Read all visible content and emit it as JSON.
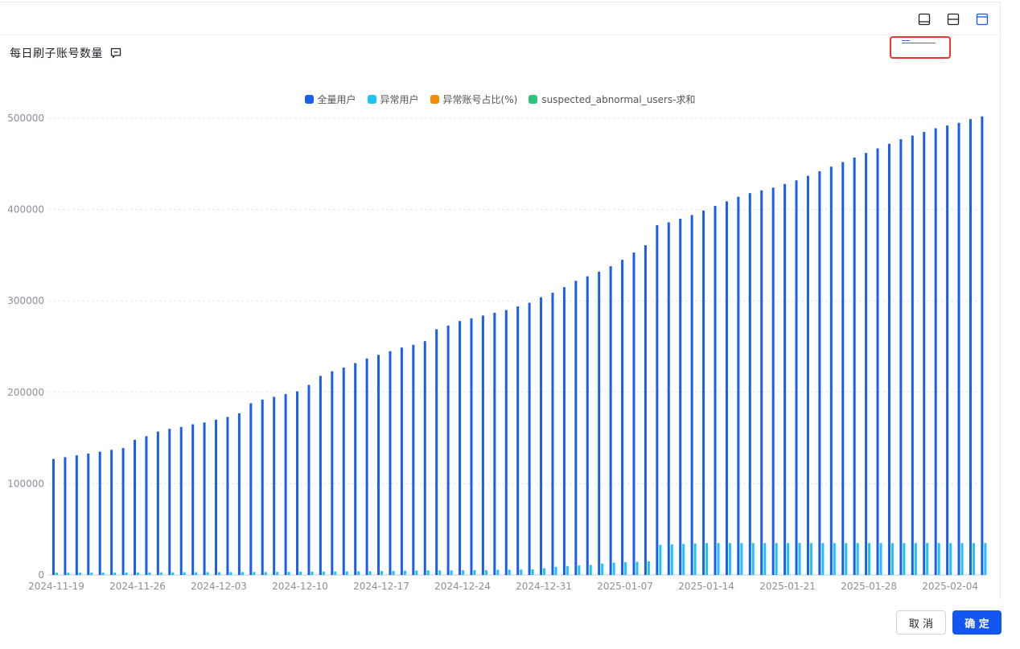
{
  "title": "每日刷子账号数量",
  "toolbar": {
    "icons": [
      "layout-bottom-panel-icon",
      "layout-split-horizontal-icon",
      "layout-top-panel-icon"
    ]
  },
  "footer": {
    "cancel_label": "取 消",
    "ok_label": "确 定"
  },
  "colors": {
    "all_users": "#1a5ef0",
    "abnormal_users": "#1ec3f5",
    "ratio": "#f58a07",
    "suspected_sum": "#2ec47a",
    "highlight": "#e53935",
    "primary_button": "#1456f0"
  },
  "chart_data": {
    "type": "bar",
    "title": "",
    "xlabel": "",
    "ylabel": "",
    "ylim": [
      0,
      500000
    ],
    "yticks": [
      "0",
      "100000",
      "200000",
      "300000",
      "400000",
      "500000"
    ],
    "xtick_labels": [
      "2024-11-19",
      "2024-11-26",
      "2024-12-03",
      "2024-12-10",
      "2024-12-17",
      "2024-12-24",
      "2024-12-31",
      "2025-01-07",
      "2025-01-14",
      "2025-01-21",
      "2025-01-28",
      "2025-02-04"
    ],
    "legend": {
      "position": "top-center",
      "items": [
        "全量用户",
        "异常用户",
        "异常账号占比(%)",
        "suspected_abnormal_users-求和"
      ]
    },
    "grid": true,
    "categories": [
      "2024-11-19",
      "2024-11-20",
      "2024-11-21",
      "2024-11-22",
      "2024-11-23",
      "2024-11-24",
      "2024-11-25",
      "2024-11-26",
      "2024-11-27",
      "2024-11-28",
      "2024-11-29",
      "2024-11-30",
      "2024-12-01",
      "2024-12-02",
      "2024-12-03",
      "2024-12-04",
      "2024-12-05",
      "2024-12-06",
      "2024-12-07",
      "2024-12-08",
      "2024-12-09",
      "2024-12-10",
      "2024-12-11",
      "2024-12-12",
      "2024-12-13",
      "2024-12-14",
      "2024-12-15",
      "2024-12-16",
      "2024-12-17",
      "2024-12-18",
      "2024-12-19",
      "2024-12-20",
      "2024-12-21",
      "2024-12-22",
      "2024-12-23",
      "2024-12-24",
      "2024-12-25",
      "2024-12-26",
      "2024-12-27",
      "2024-12-28",
      "2024-12-29",
      "2024-12-30",
      "2024-12-31",
      "2025-01-01",
      "2025-01-02",
      "2025-01-03",
      "2025-01-04",
      "2025-01-05",
      "2025-01-06",
      "2025-01-07",
      "2025-01-08",
      "2025-01-09",
      "2025-01-10",
      "2025-01-11",
      "2025-01-12",
      "2025-01-13",
      "2025-01-14",
      "2025-01-15",
      "2025-01-16",
      "2025-01-17",
      "2025-01-18",
      "2025-01-19",
      "2025-01-20",
      "2025-01-21",
      "2025-01-22",
      "2025-01-23",
      "2025-01-24",
      "2025-01-25",
      "2025-01-26",
      "2025-01-27",
      "2025-01-28",
      "2025-01-29",
      "2025-01-30",
      "2025-01-31",
      "2025-02-01",
      "2025-02-02",
      "2025-02-03",
      "2025-02-04",
      "2025-02-05",
      "2025-02-06",
      "2025-02-07"
    ],
    "series": [
      {
        "name": "全量用户",
        "values": [
          127000,
          129000,
          131000,
          133000,
          135000,
          137000,
          139000,
          148000,
          152000,
          157000,
          160000,
          162000,
          165000,
          167000,
          170000,
          173000,
          177000,
          188000,
          192000,
          195000,
          198000,
          201000,
          208000,
          218000,
          223000,
          227000,
          232000,
          237000,
          241000,
          245000,
          249000,
          252000,
          256000,
          269000,
          273000,
          278000,
          281000,
          284000,
          287000,
          290000,
          294000,
          298000,
          304000,
          309000,
          315000,
          322000,
          327000,
          332000,
          338000,
          345000,
          353000,
          361000,
          383000,
          386000,
          390000,
          394000,
          399000,
          404000,
          409000,
          414000,
          418000,
          421000,
          424000,
          428000,
          432000,
          437000,
          442000,
          447000,
          452000,
          457000,
          462000,
          467000,
          472000,
          477000,
          481000,
          485000,
          489000,
          492000,
          495000,
          499000,
          502000
        ]
      },
      {
        "name": "异常用户",
        "values": [
          2500,
          2500,
          2500,
          2600,
          2600,
          2700,
          2700,
          2800,
          2800,
          2900,
          2900,
          3000,
          3000,
          3100,
          3100,
          3200,
          3200,
          3300,
          3300,
          3400,
          3400,
          3500,
          3600,
          3700,
          3800,
          3900,
          4000,
          4100,
          4300,
          4500,
          4700,
          4800,
          5000,
          5000,
          5100,
          5200,
          5300,
          5400,
          5600,
          5800,
          6000,
          6300,
          7500,
          9000,
          9800,
          10500,
          11000,
          12500,
          13500,
          14000,
          14500,
          15000,
          33000,
          33500,
          34000,
          34500,
          35000,
          35000,
          35000,
          35000,
          35000,
          35000,
          35000,
          35000,
          35000,
          35000,
          35000,
          35000,
          35000,
          35000,
          35000,
          35000,
          35000,
          35000,
          35000,
          35000,
          35000,
          35000,
          35000,
          35000,
          35000
        ]
      }
    ]
  }
}
